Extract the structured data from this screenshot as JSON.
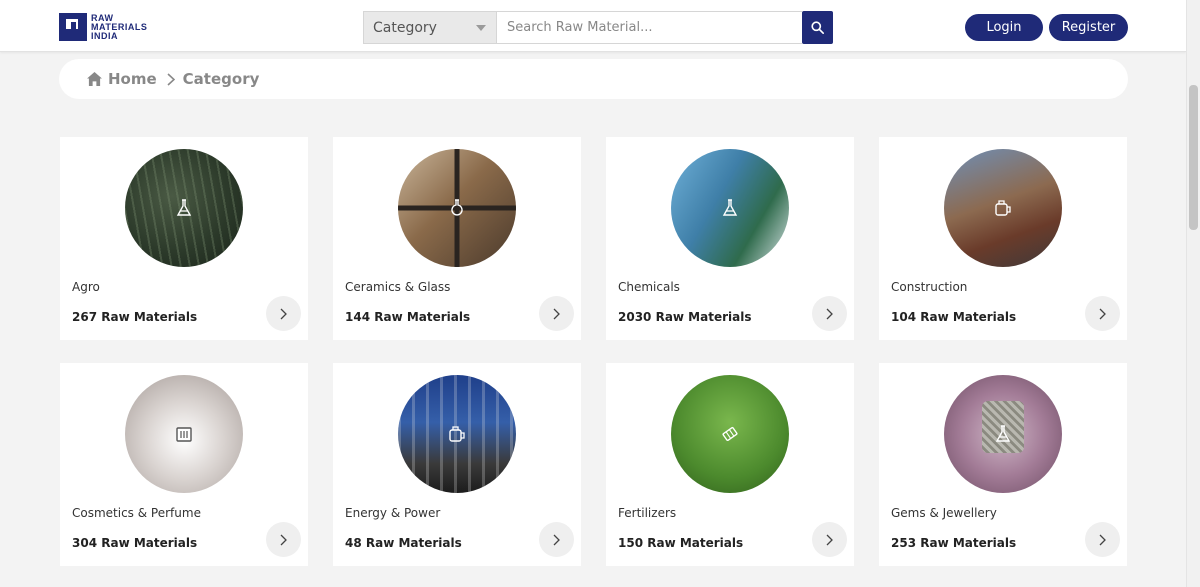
{
  "brand": {
    "logo_text": "RAW\nMATERIALS\nINDIA",
    "color": "#1f2a78"
  },
  "search": {
    "category_label": "Category",
    "placeholder": "Search Raw Material...",
    "button_icon": "search-icon"
  },
  "auth": {
    "login_label": "Login",
    "register_label": "Register"
  },
  "breadcrumb": {
    "home_label": "Home",
    "home_icon": "home-icon",
    "current_label": "Category"
  },
  "categories": [
    {
      "name": "Agro",
      "count": "267 Raw Materials",
      "icon": "flask-icon"
    },
    {
      "name": "Ceramics & Glass",
      "count": "144 Raw Materials",
      "icon": "flask-icon"
    },
    {
      "name": "Chemicals",
      "count": "2030 Raw Materials",
      "icon": "flask-icon"
    },
    {
      "name": "Construction",
      "count": "104 Raw Materials",
      "icon": "container-icon"
    },
    {
      "name": "Cosmetics & Perfume",
      "count": "304 Raw Materials",
      "icon": "cosmetics-icon"
    },
    {
      "name": "Energy & Power",
      "count": "48 Raw Materials",
      "icon": "container-icon"
    },
    {
      "name": "Fertilizers",
      "count": "150 Raw Materials",
      "icon": "bag-icon"
    },
    {
      "name": "Gems & Jewellery",
      "count": "253 Raw Materials",
      "icon": "flask-icon"
    }
  ]
}
